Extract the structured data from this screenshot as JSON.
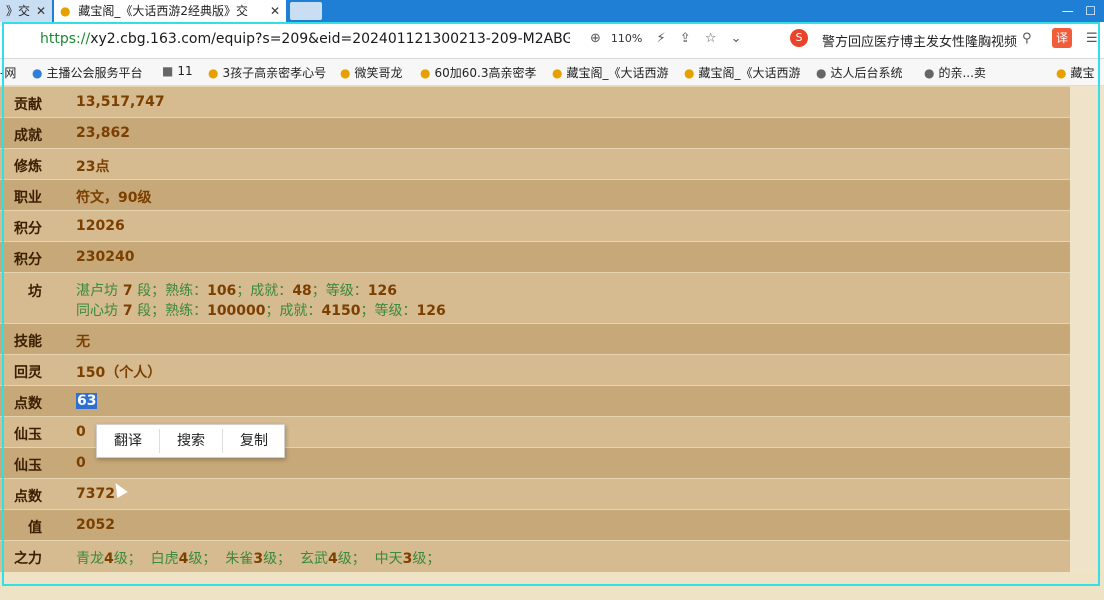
{
  "tabs": [
    {
      "title": "》交",
      "close": "✕"
    },
    {
      "title": "藏宝阁_《大话西游2经典版》交",
      "close": "✕"
    }
  ],
  "address": {
    "url_scheme": "https://",
    "url_rest": "xy2.cbg.163.com/equip?s=209&eid=202401121300213-209-M2ABGKV5(",
    "zoom": "110%",
    "news": "警方回应医疗博主发女性隆胸视频",
    "translate_btn": "译"
  },
  "bookmarks": [
    {
      "label": "-网",
      "icon": "gray"
    },
    {
      "label": "主播公会服务平台",
      "icon": "blue"
    },
    {
      "label": "11",
      "icon": "gray"
    },
    {
      "label": "3孩子高亲密孝心号",
      "icon": "yellow"
    },
    {
      "label": "微笑哥龙",
      "icon": "yellow"
    },
    {
      "label": "60加60.3高亲密孝",
      "icon": "yellow"
    },
    {
      "label": "藏宝阁_《大话西游",
      "icon": "yellow"
    },
    {
      "label": "藏宝阁_《大话西游",
      "icon": "yellow"
    },
    {
      "label": "达人后台系统",
      "icon": "gray"
    },
    {
      "label": "的亲...卖",
      "icon": "gray"
    },
    {
      "label": "藏宝",
      "icon": "yellow"
    }
  ],
  "rows": [
    {
      "label": "贡献",
      "value": "13,517,747"
    },
    {
      "label": "成就",
      "value": "23,862"
    },
    {
      "label": "修炼",
      "value": "23点"
    },
    {
      "label": "职业",
      "value": "符文，90级"
    },
    {
      "label": "积分",
      "value": "12026"
    },
    {
      "label": "积分",
      "value": "230240"
    },
    {
      "label": "坊",
      "value": ""
    },
    {
      "label": "技能",
      "value": "无"
    },
    {
      "label": "回灵",
      "value": "150（个人）"
    },
    {
      "label": "点数",
      "value": "63"
    },
    {
      "label": "仙玉",
      "value": "0"
    },
    {
      "label": "仙玉",
      "value": "0"
    },
    {
      "label": "点数",
      "value": "7372"
    },
    {
      "label": "值",
      "value": "2052"
    },
    {
      "label": "之力",
      "value": ""
    }
  ],
  "workshop": {
    "line1": {
      "name": "湛卢坊",
      "level": "7",
      "seg": "段；",
      "k1": "熟练：",
      "v1": "106",
      "k2": "；成就：",
      "v2": "48",
      "k3": "；等级：",
      "v3": "126"
    },
    "line2": {
      "name": "同心坊",
      "level": "7",
      "seg": "段；",
      "k1": "熟练：",
      "v1": "100000",
      "k2": "；成就：",
      "v2": "4150",
      "k3": "；等级：",
      "v3": "126"
    }
  },
  "beasts": [
    {
      "name": "青龙",
      "level": "4",
      "unit": "级；"
    },
    {
      "name": "白虎",
      "level": "4",
      "unit": "级；"
    },
    {
      "name": "朱雀",
      "level": "3",
      "unit": "级；"
    },
    {
      "name": "玄武",
      "level": "4",
      "unit": "级；"
    },
    {
      "name": "中天",
      "level": "3",
      "unit": "级；"
    }
  ],
  "context_menu": {
    "translate": "翻译",
    "search": "搜索",
    "copy": "复制"
  }
}
